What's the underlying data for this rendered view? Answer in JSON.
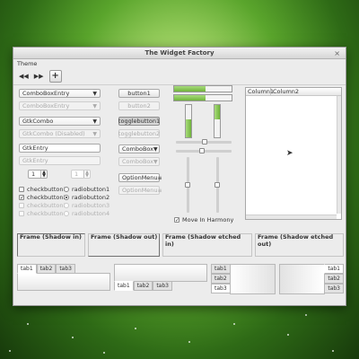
{
  "window": {
    "title": "The Widget Factory"
  },
  "menu": {
    "theme": "Theme"
  },
  "toolbar": {
    "first_icon": "first-icon",
    "last_icon": "last-icon",
    "add_icon": "add-icon"
  },
  "combos": {
    "entry_combo": "ComboBoxEntry",
    "entry_combo_disabled": "ComboBoxEntry",
    "gtk_combo": "GtkCombo",
    "gtk_combo_disabled": "GtkCombo (Disabled)",
    "gtk_entry": "GtkEntry",
    "gtk_entry_disabled": "GtkEntry"
  },
  "spins": {
    "spin1": "1",
    "spin2": "1"
  },
  "checks": {
    "checkbutton1": "checkbutton1",
    "checkbutton2": "checkbutton2",
    "checkbutton3": "checkbutton3",
    "checkbutton4": "checkbutton4",
    "radiobutton1": "radiobutton1",
    "radiobutton2": "radiobutton2",
    "radiobutton3": "radiobutton3",
    "radiobutton4": "radiobutton4"
  },
  "buttons": {
    "button1": "button1",
    "button2": "button2",
    "togglebutton1": "togglebutton1",
    "togglebutton2": "togglebutton2",
    "combobox1": "ComboBox",
    "combobox2": "ComboBox",
    "optionmenu1": "OptionMenu",
    "optionmenu2": "OptionMenu"
  },
  "move_in_harmony": "Move In Harmony",
  "treeview": {
    "columns": [
      "Column1",
      "Column2"
    ]
  },
  "frames": {
    "shadow_in": "Frame (Shadow in)",
    "shadow_out": "Frame (Shadow out)",
    "etched_in": "Frame (Shadow etched in)",
    "etched_out": "Frame (Shadow etched out)"
  },
  "notebooks": {
    "top": [
      "tab1",
      "tab2",
      "tab3"
    ],
    "bottom": [
      "tab1",
      "tab2",
      "tab3"
    ],
    "left": [
      "tab1",
      "tab2",
      "tab3"
    ],
    "right": [
      "tab1",
      "tab2",
      "tab3"
    ]
  },
  "colors": {
    "accent_green": "#7ac943",
    "desktop_dark": "#173a0b"
  }
}
